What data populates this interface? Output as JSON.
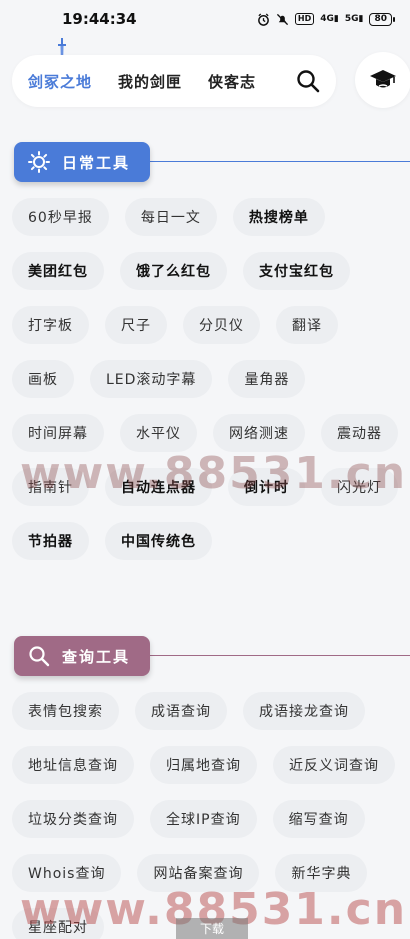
{
  "status_bar": {
    "time": "19:44:34",
    "hd_label": "HD",
    "signal1": "4G",
    "signal2": "5G",
    "battery": "80"
  },
  "nav": {
    "tabs": [
      {
        "label": "剑冢之地",
        "active": true
      },
      {
        "label": "我的剑匣",
        "active": false
      },
      {
        "label": "侠客志",
        "active": false
      }
    ]
  },
  "sections": [
    {
      "title": "日常工具",
      "color": "#4a7bd8",
      "items": [
        {
          "label": "60秒早报",
          "bold": false
        },
        {
          "label": "每日一文",
          "bold": false
        },
        {
          "label": "热搜榜单",
          "bold": true
        },
        {
          "label": "美团红包",
          "bold": true
        },
        {
          "label": "饿了么红包",
          "bold": true
        },
        {
          "label": "支付宝红包",
          "bold": true
        },
        {
          "label": "打字板",
          "bold": false
        },
        {
          "label": "尺子",
          "bold": false
        },
        {
          "label": "分贝仪",
          "bold": false
        },
        {
          "label": "翻译",
          "bold": false
        },
        {
          "label": "画板",
          "bold": false
        },
        {
          "label": "LED滚动字幕",
          "bold": false
        },
        {
          "label": "量角器",
          "bold": false
        },
        {
          "label": "时间屏幕",
          "bold": false
        },
        {
          "label": "水平仪",
          "bold": false
        },
        {
          "label": "网络测速",
          "bold": false
        },
        {
          "label": "震动器",
          "bold": false
        },
        {
          "label": "指南针",
          "bold": false
        },
        {
          "label": "自动连点器",
          "bold": true
        },
        {
          "label": "倒计时",
          "bold": true
        },
        {
          "label": "闪光灯",
          "bold": false
        },
        {
          "label": "节拍器",
          "bold": true
        },
        {
          "label": "中国传统色",
          "bold": true
        }
      ]
    },
    {
      "title": "查询工具",
      "color": "#a06a86",
      "items": [
        {
          "label": "表情包搜索",
          "bold": false
        },
        {
          "label": "成语查询",
          "bold": false
        },
        {
          "label": "成语接龙查询",
          "bold": false
        },
        {
          "label": "地址信息查询",
          "bold": false
        },
        {
          "label": "归属地查询",
          "bold": false
        },
        {
          "label": "近反义词查询",
          "bold": false
        },
        {
          "label": "垃圾分类查询",
          "bold": false
        },
        {
          "label": "全球IP查询",
          "bold": false
        },
        {
          "label": "缩写查询",
          "bold": false
        },
        {
          "label": "Whois查询",
          "bold": false
        },
        {
          "label": "网站备案查询",
          "bold": false
        },
        {
          "label": "新华字典",
          "bold": false
        },
        {
          "label": "星座配对",
          "bold": false
        }
      ]
    }
  ],
  "watermark": {
    "text": "www.88531.cn",
    "color": "#8b4b4b"
  },
  "download_label": "下载"
}
